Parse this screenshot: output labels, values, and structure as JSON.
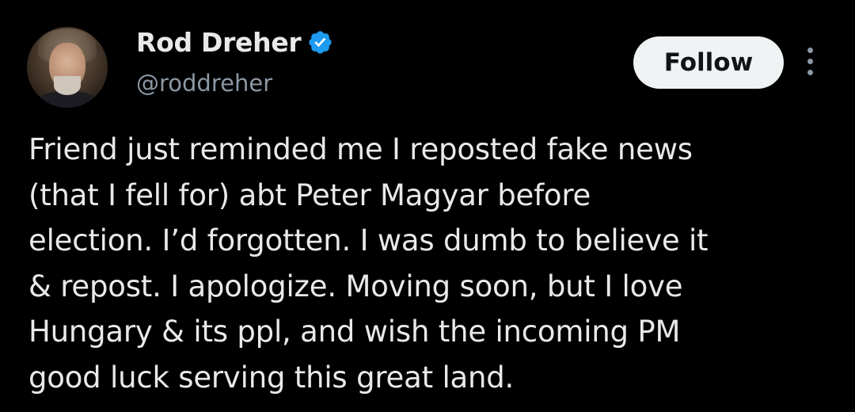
{
  "author": {
    "display_name": "Rod Dreher",
    "handle": "@roddreher",
    "verified": true,
    "avatar_icon": "profile-photo"
  },
  "actions": {
    "follow_label": "Follow",
    "more_icon": "more-vertical-icon"
  },
  "tweet": {
    "text": "Friend just reminded me I reposted fake news\n(that I fell for) abt Peter Magyar before\nelection. I’d forgotten. I was dumb to believe it\n& repost. I apologize. Moving soon, but I love\nHungary & its ppl, and wish the incoming PM\ngood luck serving this great land."
  },
  "colors": {
    "background": "#000000",
    "text_primary": "#e7e9ea",
    "text_secondary": "#8b98a5",
    "verified_blue": "#1d9bf0",
    "button_bg": "#eff3f4"
  }
}
